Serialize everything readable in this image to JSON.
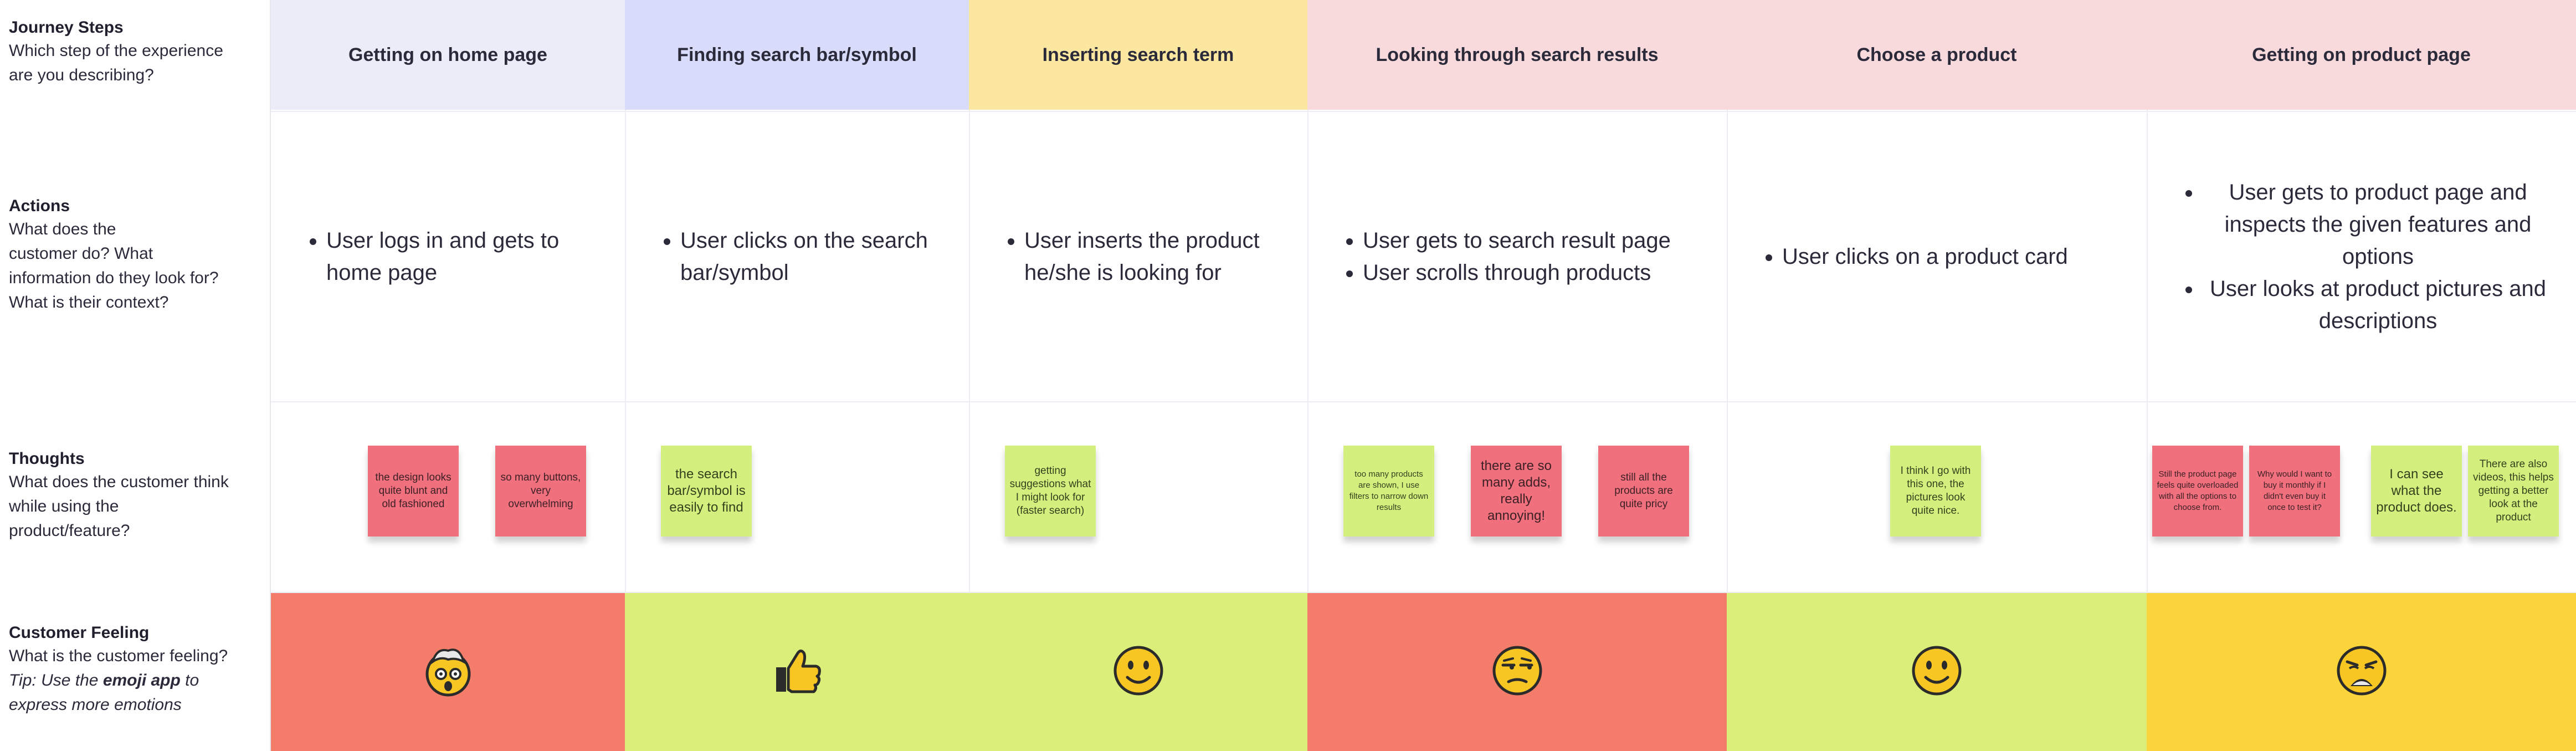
{
  "row_labels": {
    "journey": {
      "title": "Journey Steps",
      "desc": [
        "Which step of the experience",
        "are you describing?"
      ]
    },
    "actions": {
      "title": "Actions",
      "desc": [
        "What does the",
        "customer do? What",
        "information do they look for?",
        "What is their context?"
      ]
    },
    "thoughts": {
      "title": "Thoughts",
      "desc": [
        "What does the customer think",
        "while using the",
        "product/feature?"
      ]
    },
    "feeling": {
      "title": "Customer Feeling",
      "desc": "What is the customer feeling?",
      "tip_prefix": "Tip: Use the ",
      "tip_bold": "emoji app",
      "tip_mid": " to",
      "tip_line2": "express more emotions"
    }
  },
  "steps": [
    {
      "title": "Getting on home page",
      "header_color": "#ececf9",
      "actions": [
        "User logs in and gets to home page"
      ],
      "stickies": [
        {
          "text": "the design looks quite blunt and old fashioned",
          "color": "pink"
        },
        {
          "text": "so many buttons, very overwhelming",
          "color": "pink"
        }
      ],
      "feeling_color": "#f47c6a",
      "emoji": "face-with-exploding-head-icon"
    },
    {
      "title": "Finding search bar/symbol",
      "header_color": "#d8dcfa",
      "actions": [
        "User clicks on the search bar/symbol"
      ],
      "stickies": [
        {
          "text": "the search bar/symbol is easily to find",
          "color": "green"
        }
      ],
      "feeling_color": "#dcee7a",
      "emoji": "thumbs-up-icon"
    },
    {
      "title": "Inserting search term",
      "header_color": "#fbe79f",
      "actions": [
        "User inserts the product he/she is looking for"
      ],
      "stickies": [
        {
          "text": "getting suggestions what I might look for (faster search)",
          "color": "green"
        }
      ],
      "feeling_color": "#dcee7a",
      "emoji": "slightly-smiling-face-icon"
    },
    {
      "title": "Looking through search results",
      "header_color": "#f8d9dc",
      "actions": [
        "User gets to search result page",
        "User scrolls through products"
      ],
      "stickies": [
        {
          "text": "too many products are shown, I use filters to narrow down results",
          "color": "green"
        },
        {
          "text": "there are so many adds, really annoying!",
          "color": "pink"
        },
        {
          "text": "still all the products are quite pricy",
          "color": "pink"
        }
      ],
      "feeling_color": "#f47c6a",
      "emoji": "unamused-face-icon"
    },
    {
      "title": "Choose a product",
      "header_color": "#f8d9dc",
      "actions": [
        "User clicks on a product card"
      ],
      "stickies": [
        {
          "text": "I think I go with this one, the pictures look quite nice.",
          "color": "green"
        }
      ],
      "feeling_color": "#dcee7a",
      "emoji": "slightly-smiling-face-icon"
    },
    {
      "title": "Getting on product page",
      "header_color": "#f8d9dc",
      "actions": [
        "User gets to product page and inspects the given features and options",
        "User looks at product pictures and descriptions"
      ],
      "stickies": [
        {
          "text": "Still the product page feels quite overloaded with all the options to choose from.",
          "color": "pink"
        },
        {
          "text": "Why would I want to buy it monthly if I didn't even buy it once to test it?",
          "color": "pink"
        },
        {
          "text": "I can see what the product does.",
          "color": "green"
        },
        {
          "text": "There are also videos, this helps getting a better look at the product",
          "color": "green"
        }
      ],
      "feeling_color": "#fbd33a",
      "emoji": "weary-face-icon"
    }
  ]
}
